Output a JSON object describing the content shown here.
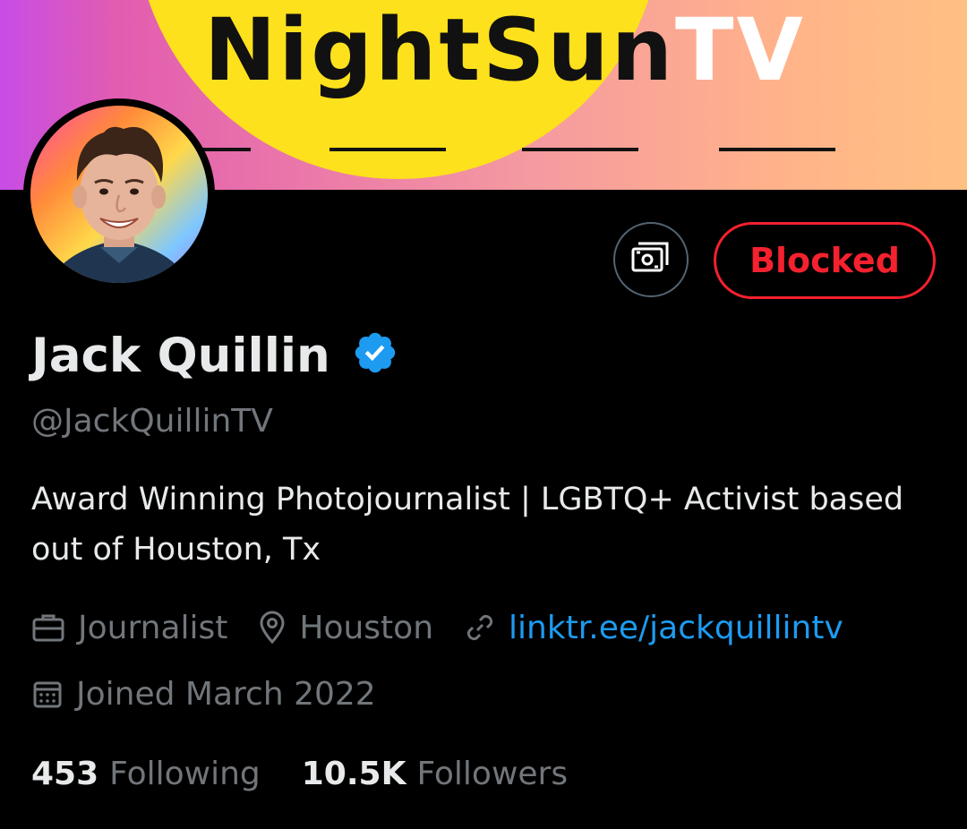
{
  "banner": {
    "title_part1": "NightSun",
    "title_part2": "TV",
    "colors": {
      "sun": "#fde11d",
      "left": "#c74de6",
      "right": "#ffc082"
    }
  },
  "profile": {
    "name": "Jack Quillin",
    "handle": "@JackQuillinTV",
    "verified": true,
    "bio": "Award Winning Photojournalist | LGBTQ+ Activist based out of Houston, Tx",
    "profession": "Journalist",
    "location": "Houston",
    "website": "linktr.ee/jackquillintv",
    "joined": "Joined March 2022",
    "avatar": "profile-photo"
  },
  "actions": {
    "tip_icon": "money-icon",
    "blocked_label": "Blocked"
  },
  "stats": {
    "following_count": "453",
    "following_label": "Following",
    "followers_count": "10.5K",
    "followers_label": "Followers"
  },
  "colors": {
    "background": "#000000",
    "text_primary": "#e7e9ea",
    "text_secondary": "#71767b",
    "link": "#1d9bf0",
    "blocked": "#f4212e",
    "verified": "#1d9bf0"
  }
}
